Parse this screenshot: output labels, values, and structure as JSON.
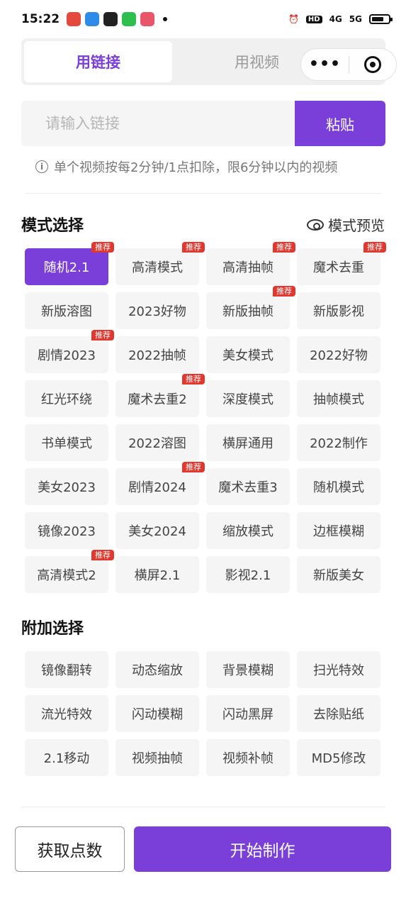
{
  "status_bar": {
    "time": "15:22",
    "network": "4G",
    "network2": "5G",
    "hd_label": "HD"
  },
  "tabs": [
    {
      "label": "用链接",
      "active": true
    },
    {
      "label": "用视频",
      "active": false
    }
  ],
  "capsule": {
    "more": "•••"
  },
  "link_input": {
    "placeholder": "请输入链接",
    "value": ""
  },
  "paste_button": "粘贴",
  "tip": {
    "icon": "i",
    "text": "单个视频按每2分钟/1点扣除，限6分钟以内的视频"
  },
  "mode_section": {
    "title": "模式选择",
    "preview_label": "模式预览",
    "badge_text": "推荐",
    "modes": [
      {
        "label": "随机2.1",
        "badge": true,
        "selected": true
      },
      {
        "label": "高清模式",
        "badge": true
      },
      {
        "label": "高清抽帧",
        "badge": true
      },
      {
        "label": "魔术去重",
        "badge": true
      },
      {
        "label": "新版溶图"
      },
      {
        "label": "2023好物"
      },
      {
        "label": "新版抽帧",
        "badge": true
      },
      {
        "label": "新版影视"
      },
      {
        "label": "剧情2023",
        "badge": true
      },
      {
        "label": "2022抽帧"
      },
      {
        "label": "美女模式"
      },
      {
        "label": "2022好物"
      },
      {
        "label": "红光环绕"
      },
      {
        "label": "魔术去重2",
        "badge": true
      },
      {
        "label": "深度模式"
      },
      {
        "label": "抽帧模式"
      },
      {
        "label": "书单模式"
      },
      {
        "label": "2022溶图"
      },
      {
        "label": "横屏通用"
      },
      {
        "label": "2022制作"
      },
      {
        "label": "美女2023"
      },
      {
        "label": "剧情2024",
        "badge": true
      },
      {
        "label": "魔术去重3"
      },
      {
        "label": "随机模式"
      },
      {
        "label": "镜像2023"
      },
      {
        "label": "美女2024"
      },
      {
        "label": "缩放模式"
      },
      {
        "label": "边框模糊"
      },
      {
        "label": "高清模式2",
        "badge": true
      },
      {
        "label": "横屏2.1"
      },
      {
        "label": "影视2.1"
      },
      {
        "label": "新版美女"
      }
    ]
  },
  "extra_section": {
    "title": "附加选择",
    "options": [
      {
        "label": "镜像翻转"
      },
      {
        "label": "动态缩放"
      },
      {
        "label": "背景模糊"
      },
      {
        "label": "扫光特效"
      },
      {
        "label": "流光特效"
      },
      {
        "label": "闪动模糊"
      },
      {
        "label": "闪动黑屏"
      },
      {
        "label": "去除贴纸"
      },
      {
        "label": "2.1移动"
      },
      {
        "label": "视频抽帧"
      },
      {
        "label": "视频补帧"
      },
      {
        "label": "MD5修改"
      }
    ]
  },
  "bottom": {
    "get_points": "获取点数",
    "start": "开始制作"
  },
  "colors": {
    "accent": "#7a3fd8",
    "badge": "#e0382f",
    "chip_bg": "#f5f5f5"
  }
}
